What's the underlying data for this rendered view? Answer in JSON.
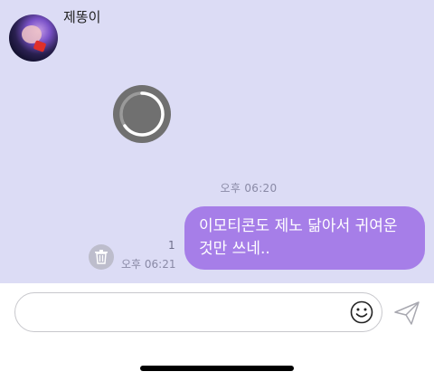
{
  "chat": {
    "sender_name": "제똥이",
    "timestamp": "오후 06:20",
    "my_message": {
      "text_line1": "이모티콘도 제노 닮아서 귀여운",
      "text_line2": "것만 쓰네..",
      "unread_count": "1",
      "time": "오후 06:21"
    }
  },
  "input": {
    "placeholder": "",
    "value": ""
  },
  "icons": {
    "emoji": "smiley-icon",
    "send": "paper-plane-icon",
    "delete": "trash-icon",
    "loading": "loading-spinner-icon"
  },
  "colors": {
    "chat_background": "#dcdcf5",
    "my_bubble": "#a67ee8",
    "spinner": "#707070"
  }
}
